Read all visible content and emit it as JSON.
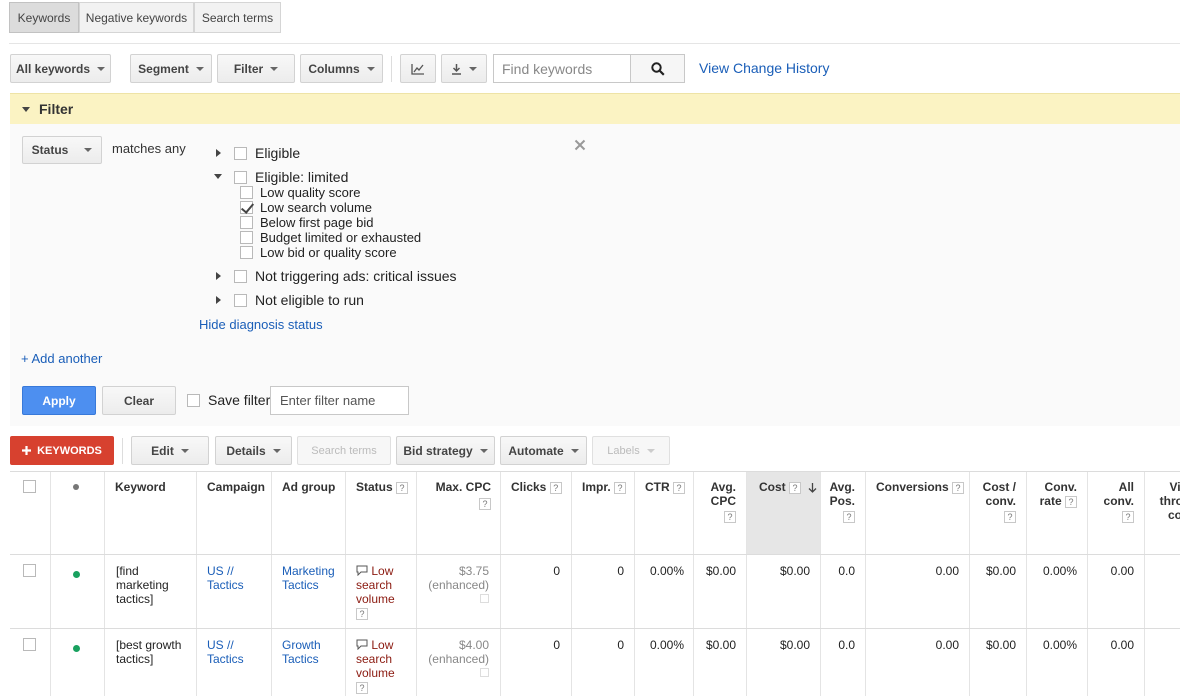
{
  "tabs": [
    "Keywords",
    "Negative keywords",
    "Search terms"
  ],
  "toolbar": {
    "all_keywords": "All keywords",
    "segment": "Segment",
    "filter": "Filter",
    "columns": "Columns",
    "search_placeholder": "Find keywords",
    "view_change_history": "View Change History"
  },
  "filter": {
    "header": "Filter",
    "field": "Status",
    "operator": "matches any",
    "options": [
      {
        "label": "Eligible",
        "checked": false,
        "expanded": false
      },
      {
        "label": "Eligible: limited",
        "checked": false,
        "expanded": true
      },
      {
        "label": "Not triggering ads: critical issues",
        "checked": false,
        "expanded": false
      },
      {
        "label": "Not eligible to run",
        "checked": false,
        "expanded": false
      }
    ],
    "sub_options": [
      {
        "label": "Low quality score",
        "checked": false
      },
      {
        "label": "Low search volume",
        "checked": true
      },
      {
        "label": "Below first page bid",
        "checked": false
      },
      {
        "label": "Budget limited or exhausted",
        "checked": false
      },
      {
        "label": "Low bid or quality score",
        "checked": false
      }
    ],
    "hide_diagnosis": "Hide diagnosis status",
    "add_another": "+ Add another",
    "apply": "Apply",
    "clear": "Clear",
    "save_filter": "Save filter",
    "filter_name_placeholder": "Enter filter name"
  },
  "actions": {
    "add_keywords": "KEYWORDS",
    "edit": "Edit",
    "details": "Details",
    "search_terms": "Search terms",
    "bid_strategy": "Bid strategy",
    "automate": "Automate",
    "labels": "Labels"
  },
  "table": {
    "headers": {
      "keyword": "Keyword",
      "campaign": "Campaign",
      "ad_group": "Ad group",
      "status": "Status",
      "max_cpc": "Max. CPC",
      "clicks": "Clicks",
      "impr": "Impr.",
      "ctr": "CTR",
      "avg_cpc_1": "Avg.",
      "avg_cpc_2": "CPC",
      "cost": "Cost",
      "avg_pos_1": "Avg.",
      "avg_pos_2": "Pos.",
      "conversions": "Conversions",
      "cost_conv_1": "Cost /",
      "cost_conv_2": "conv.",
      "conv_rate_1": "Conv.",
      "conv_rate_2": "rate",
      "all_conv_1": "All",
      "all_conv_2": "conv.",
      "view_through_1": "Vi",
      "view_through_2": "throu",
      "view_through_3": "co"
    },
    "rows": [
      {
        "keyword": [
          "[find",
          "marketing",
          "tactics]"
        ],
        "campaign": [
          "US //",
          "Tactics"
        ],
        "ad_group": [
          "Marketing",
          "Tactics"
        ],
        "status": [
          "Low",
          "search",
          "volume"
        ],
        "max_cpc": "$3.75",
        "max_cpc_note": "(enhanced)",
        "clicks": "0",
        "impr": "0",
        "ctr": "0.00%",
        "avg_cpc": "$0.00",
        "cost": "$0.00",
        "avg_pos": "0.0",
        "conversions": "0.00",
        "cost_conv": "$0.00",
        "conv_rate": "0.00%",
        "all_conv": "0.00"
      },
      {
        "keyword": [
          "[best growth",
          "tactics]"
        ],
        "campaign": [
          "US //",
          "Tactics"
        ],
        "ad_group": [
          "Growth",
          "Tactics"
        ],
        "status": [
          "Low",
          "search",
          "volume"
        ],
        "max_cpc": "$4.00",
        "max_cpc_note": "(enhanced)",
        "clicks": "0",
        "impr": "0",
        "ctr": "0.00%",
        "avg_cpc": "$0.00",
        "cost": "$0.00",
        "avg_pos": "0.0",
        "conversions": "0.00",
        "cost_conv": "$0.00",
        "conv_rate": "0.00%",
        "all_conv": "0.00"
      }
    ]
  },
  "colors": {
    "filter_header_bg": "#fbf3c3",
    "apply_blue": "#4d8ff0",
    "add_red": "#d7412f",
    "link_blue": "#1a5eb8",
    "status_red": "#8b1a10",
    "eligible_green": "#19a15f"
  }
}
